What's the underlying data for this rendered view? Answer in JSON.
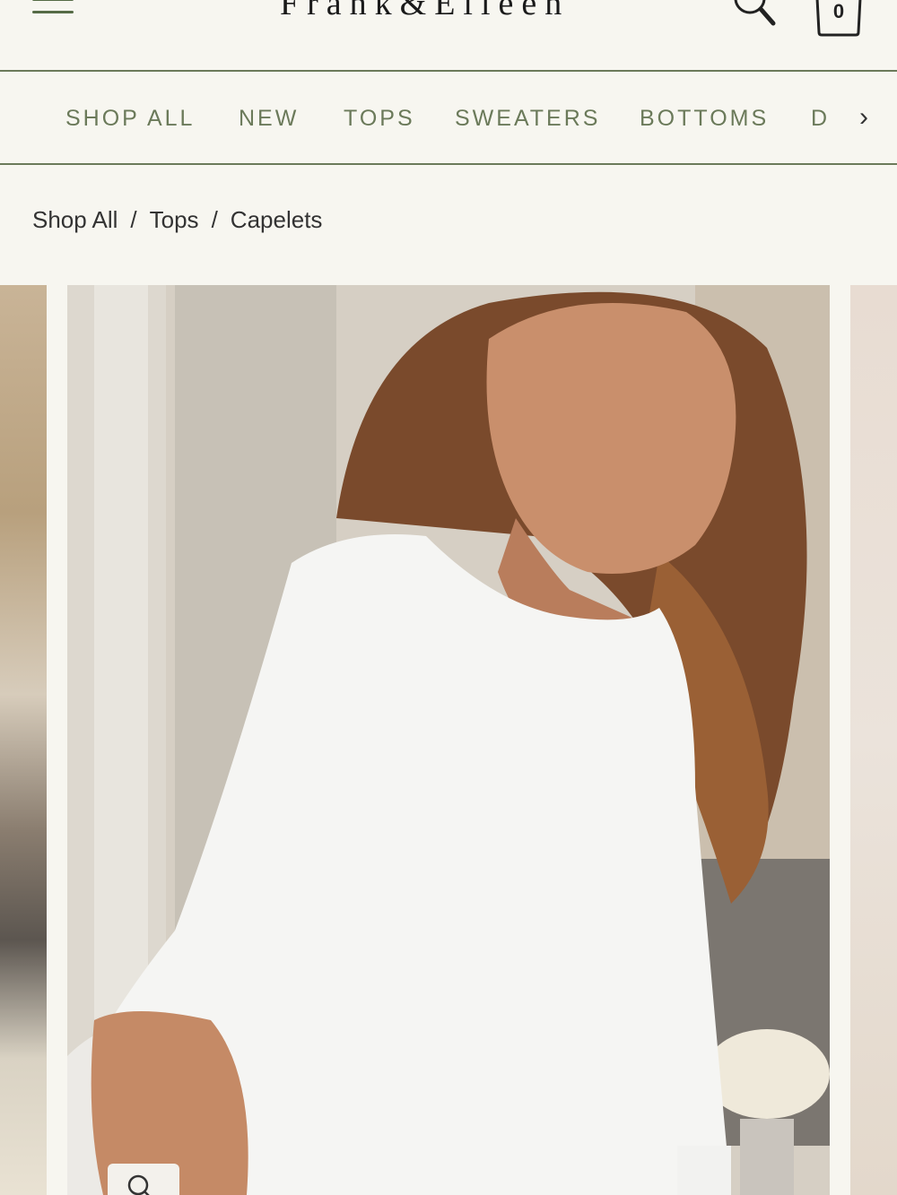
{
  "header": {
    "logo_text": "Frank&Eileen",
    "cart_count": "0"
  },
  "nav": {
    "items": [
      {
        "label": "SHOP ALL"
      },
      {
        "label": "NEW"
      },
      {
        "label": "TOPS"
      },
      {
        "label": "SWEATERS"
      },
      {
        "label": "BOTTOMS"
      },
      {
        "label": "D"
      }
    ],
    "next_arrow": "›"
  },
  "breadcrumb": {
    "items": [
      "Shop All",
      "Tops",
      "Capelets"
    ],
    "separator": "/"
  },
  "product_gallery": {
    "main_image_alt": "Woman wearing white oversized short-sleeve capelet top",
    "zoom_icon": "search-icon"
  },
  "colors": {
    "background": "#f7f6f0",
    "accent_green": "#6b7a5a",
    "text_dark": "#333333"
  }
}
